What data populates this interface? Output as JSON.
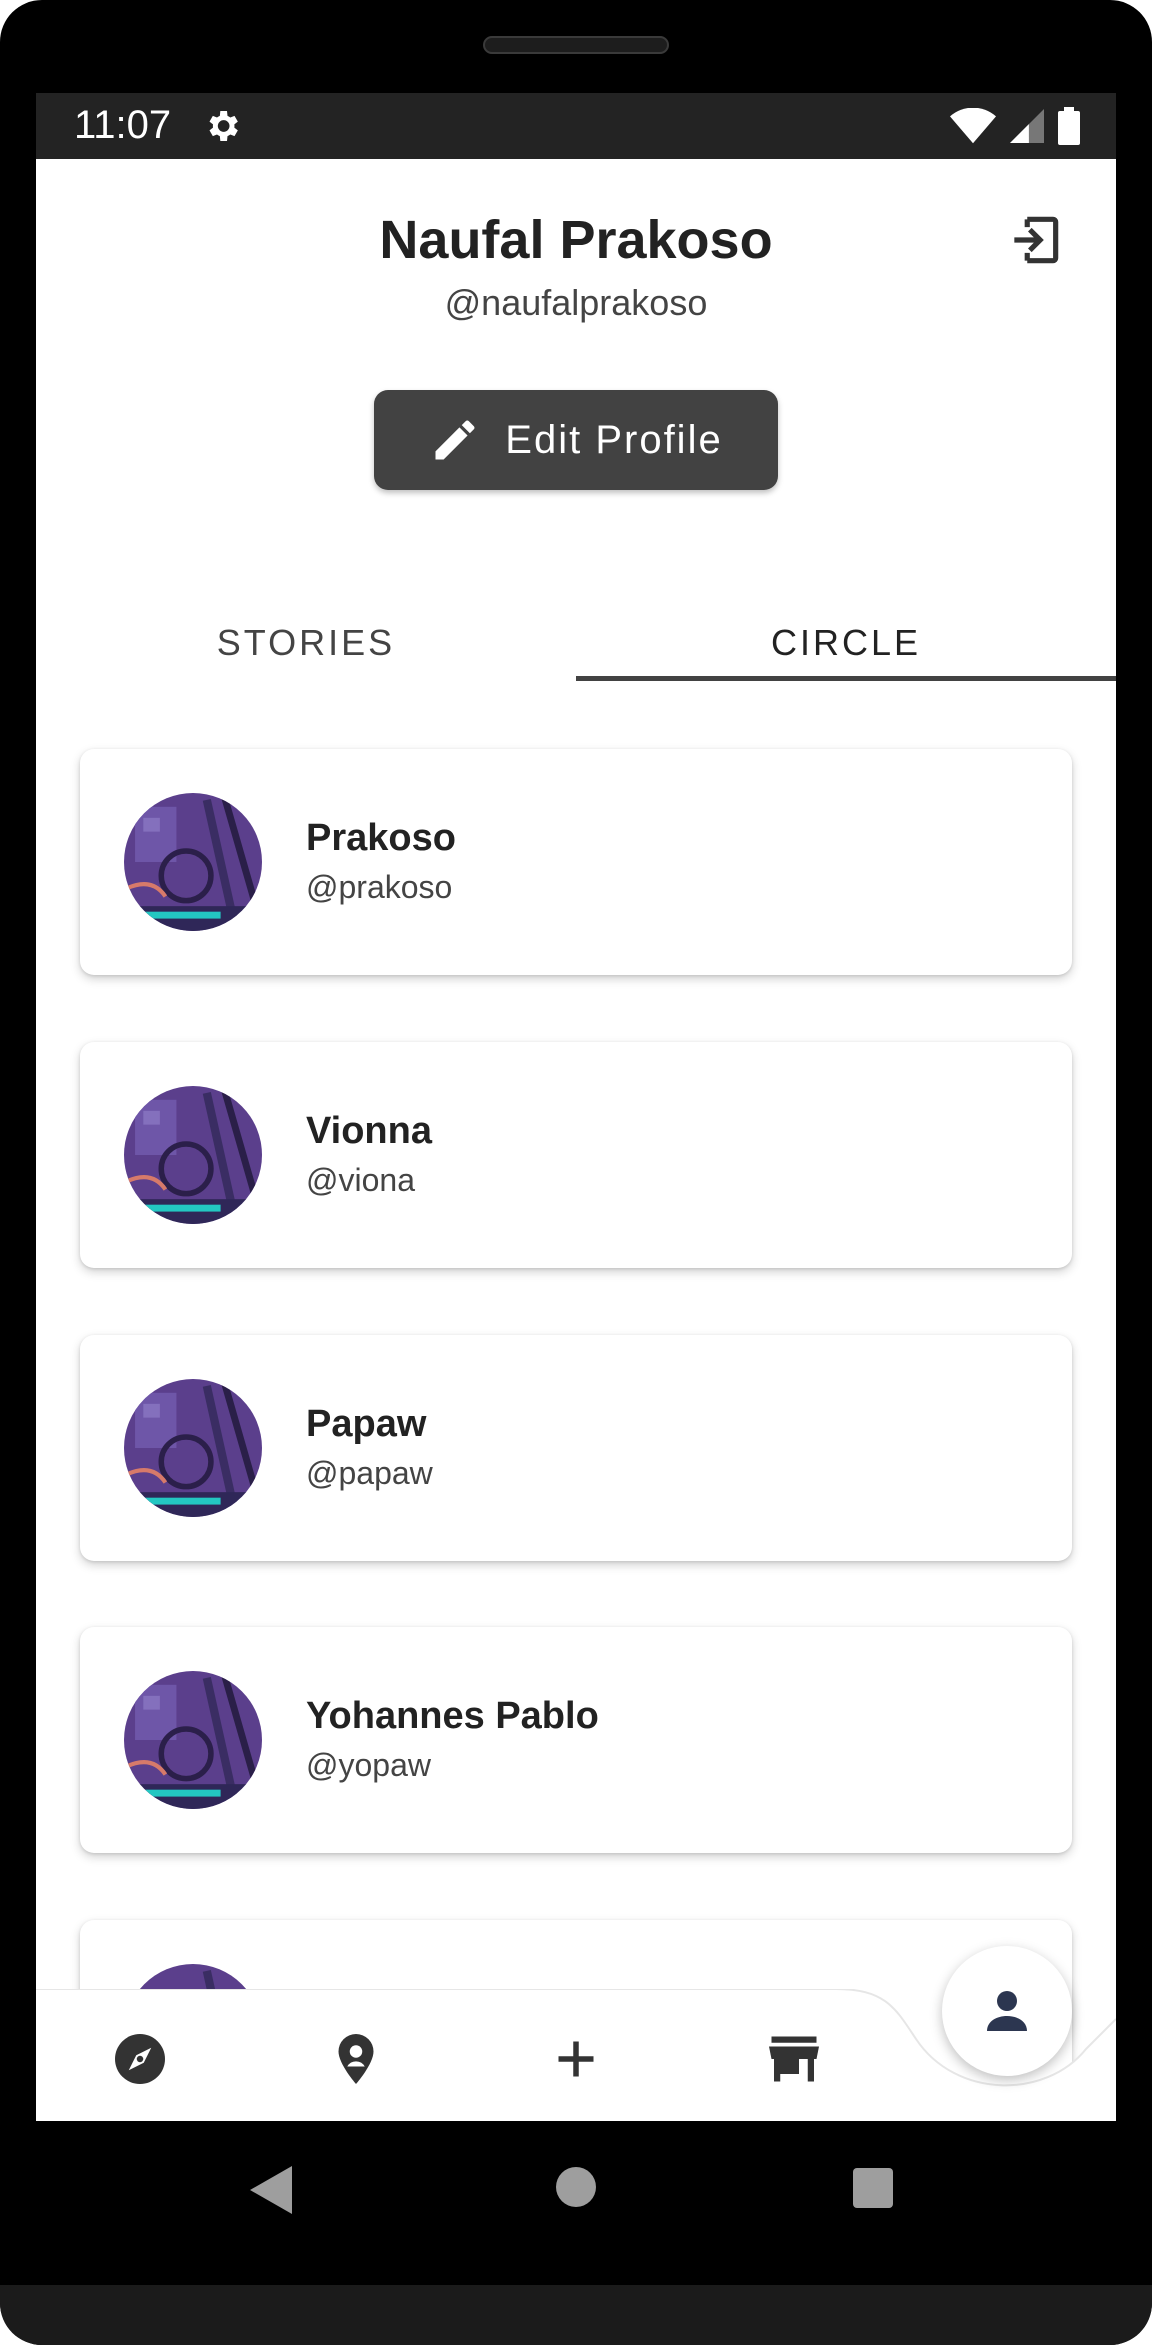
{
  "status_bar": {
    "time": "11:07"
  },
  "profile": {
    "name": "Naufal Prakoso",
    "handle": "@naufalprakoso",
    "edit_label": "Edit Profile"
  },
  "tabs": [
    {
      "label": "STORIES",
      "active": false
    },
    {
      "label": "CIRCLE",
      "active": true
    }
  ],
  "circle": [
    {
      "name": "Prakoso",
      "handle": "@prakoso"
    },
    {
      "name": "Vionna",
      "handle": "@viona"
    },
    {
      "name": "Papaw",
      "handle": "@papaw"
    },
    {
      "name": "Yohannes Pablo",
      "handle": "@yopaw"
    }
  ],
  "bottom_nav": [
    {
      "icon": "compass-icon"
    },
    {
      "icon": "location-pin-icon"
    },
    {
      "icon": "add-icon"
    },
    {
      "icon": "store-icon"
    },
    {
      "icon": "person-icon",
      "active": true
    }
  ],
  "colors": {
    "dark_button": "#424242",
    "status_bar": "#232323",
    "nav_icon": "#333333",
    "fab_icon": "#2c3650",
    "avatar_bg": "#5b3f8c"
  }
}
